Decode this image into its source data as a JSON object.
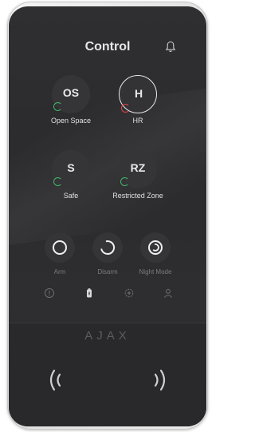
{
  "header": {
    "title": "Control",
    "bell_icon": "bell-icon"
  },
  "zones": [
    {
      "abbr": "OS",
      "label": "Open Space",
      "status_color": "#3fb86a",
      "selected": false
    },
    {
      "abbr": "H",
      "label": "HR",
      "status_color": "#e0444a",
      "selected": true
    },
    {
      "abbr": "S",
      "label": "Safe",
      "status_color": "#3fb86a",
      "selected": false
    },
    {
      "abbr": "RZ",
      "label": "Restricted Zone",
      "status_color": "#3fb86a",
      "selected": false
    }
  ],
  "actions": [
    {
      "label": "Arm",
      "icon": "arm-ring-icon"
    },
    {
      "label": "Disarm",
      "icon": "disarm-open-ring-icon"
    },
    {
      "label": "Night Mode",
      "icon": "night-mode-icon"
    }
  ],
  "tabs": [
    {
      "icon": "alarm-exclamation-icon"
    },
    {
      "icon": "battery-flame-icon"
    },
    {
      "icon": "medical-gear-icon"
    },
    {
      "icon": "user-icon"
    }
  ],
  "brand": {
    "logo": "AJAX"
  },
  "colors": {
    "screen": "#2d2d2f",
    "accent_green": "#3fb86a",
    "accent_red": "#e0444a",
    "frame": "#e2e2e2"
  }
}
